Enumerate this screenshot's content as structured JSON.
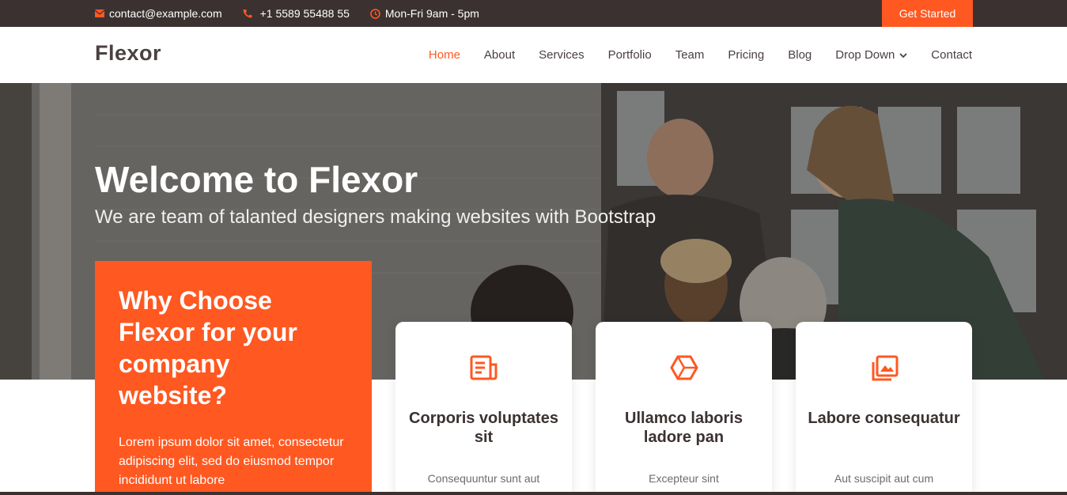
{
  "topbar": {
    "email": "contact@example.com",
    "phone": "+1 5589 55488 55",
    "hours": "Mon-Fri 9am - 5pm",
    "cta_label": "Get Started"
  },
  "header": {
    "logo": "Flexor",
    "nav": [
      {
        "label": "Home",
        "active": true
      },
      {
        "label": "About"
      },
      {
        "label": "Services"
      },
      {
        "label": "Portfolio"
      },
      {
        "label": "Team"
      },
      {
        "label": "Pricing"
      },
      {
        "label": "Blog"
      },
      {
        "label": "Drop Down"
      },
      {
        "label": "Contact"
      }
    ]
  },
  "hero": {
    "title": "Welcome to Flexor",
    "subtitle": "We are team of talanted designers making websites with Bootstrap"
  },
  "why": {
    "title": "Why Choose Flexor for your company website?",
    "text": "Lorem ipsum dolor sit amet, consectetur adipiscing elit, sed do eiusmod tempor incididunt ut labore"
  },
  "cards": [
    {
      "icon": "document-icon",
      "title": "Corporis voluptates sit",
      "desc": "Consequuntur sunt aut"
    },
    {
      "icon": "cube-icon",
      "title": "Ullamco laboris ladore pan",
      "desc": "Excepteur sint"
    },
    {
      "icon": "images-icon",
      "title": "Labore consequatur",
      "desc": "Aut suscipit aut cum"
    }
  ],
  "colors": {
    "accent": "#ff5821",
    "topbar": "#3c3131",
    "text": "#4a4141"
  }
}
